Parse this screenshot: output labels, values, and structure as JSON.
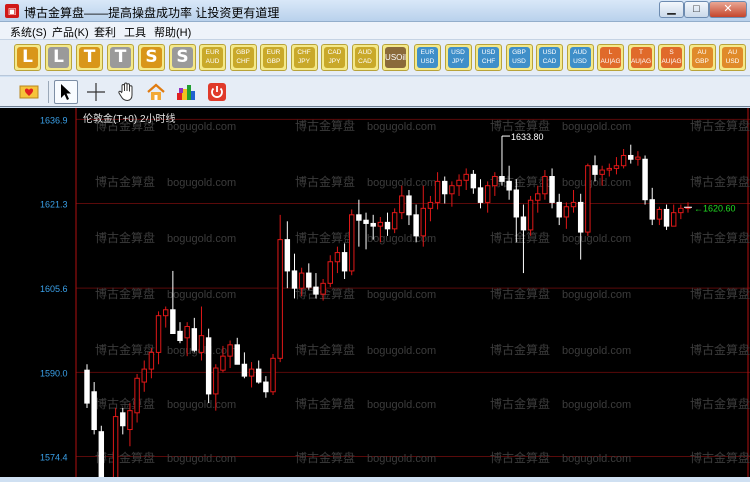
{
  "window": {
    "title": "博古金算盘——提高操盘成功率 让投资更有道理",
    "app_icon": "abacus-logo-icon",
    "controls": {
      "minimize": "▁",
      "maximize": "□",
      "close": "✕"
    }
  },
  "menu": {
    "items": [
      {
        "label": "系统(S)"
      },
      {
        "label": "产品(K)"
      },
      {
        "label": "套利"
      },
      {
        "label": "工具"
      },
      {
        "label": "帮助(H)"
      }
    ]
  },
  "toolbar": {
    "letter_buttons": [
      {
        "label": "L",
        "color": "#d9961a"
      },
      {
        "label": "L",
        "color": "#9a9a9a"
      },
      {
        "label": "T",
        "color": "#d9961a"
      },
      {
        "label": "T",
        "color": "#9a9a9a"
      },
      {
        "label": "S",
        "color": "#d9961a"
      },
      {
        "label": "S",
        "color": "#9a9a9a"
      }
    ],
    "pair_buttons": [
      {
        "top": "EUR",
        "bottom": "AUD",
        "color": "#c9a92a"
      },
      {
        "top": "GBP",
        "bottom": "CHF",
        "color": "#c9a92a"
      },
      {
        "top": "EUR",
        "bottom": "GBP",
        "color": "#c9a92a"
      },
      {
        "top": "CHF",
        "bottom": "JPY",
        "color": "#c9a92a"
      },
      {
        "top": "CAD",
        "bottom": "JPY",
        "color": "#c9a92a"
      },
      {
        "top": "AUD",
        "bottom": "CAD",
        "color": "#c9a92a"
      },
      {
        "top": "USOil",
        "bottom": "",
        "color": "#8a6a3a"
      },
      {
        "top": "EUR",
        "bottom": "USD",
        "color": "#3f8fc9"
      },
      {
        "top": "USD",
        "bottom": "JPY",
        "color": "#3f8fc9"
      },
      {
        "top": "USD",
        "bottom": "CHF",
        "color": "#3f8fc9"
      },
      {
        "top": "GBP",
        "bottom": "USD",
        "color": "#3f8fc9"
      },
      {
        "top": "USD",
        "bottom": "CAD",
        "color": "#3f8fc9"
      },
      {
        "top": "AUD",
        "bottom": "USD",
        "color": "#3f8fc9"
      },
      {
        "top": "L",
        "bottom": "AU|AG",
        "color": "#e06a2a"
      },
      {
        "top": "T",
        "bottom": "AU|AG",
        "color": "#e06a2a"
      },
      {
        "top": "S",
        "bottom": "AU|AG",
        "color": "#e06a2a"
      },
      {
        "top": "AU",
        "bottom": "GBP",
        "color": "#e08a2a"
      },
      {
        "top": "AU",
        "bottom": "USD",
        "color": "#e08a2a"
      }
    ]
  },
  "tools": [
    {
      "name": "envelope-icon",
      "selected": false
    },
    {
      "name": "arrow-cursor-icon",
      "selected": true
    },
    {
      "name": "crosshair-icon",
      "selected": false
    },
    {
      "name": "hand-icon",
      "selected": false
    },
    {
      "name": "home-icon",
      "selected": false
    },
    {
      "name": "color-blocks-icon",
      "selected": false
    },
    {
      "name": "power-icon",
      "selected": false
    }
  ],
  "chart": {
    "title": "伦敦金(T+0) 2小时线",
    "watermark_cn": "博古金算盘",
    "watermark_en": "bogugold.com",
    "max_label": "1633.80",
    "last_label": "←1620.60",
    "colors": {
      "up": "#e01818",
      "down": "#ffffff",
      "axis_text": "#3aa0e8",
      "grid": "#5a0a0a",
      "last": "#22dd22"
    }
  },
  "chart_data": {
    "type": "candlestick",
    "title": "伦敦金(T+0) 2小时线",
    "y_ticks": [
      1636.9,
      1621.3,
      1605.6,
      1590.0,
      1574.4
    ],
    "ylim": [
      1570.6,
      1639.0
    ],
    "annotations": [
      {
        "text": "1633.80",
        "value": 1633.8
      },
      {
        "text": "←1620.60",
        "value": 1620.6
      }
    ],
    "candles": [
      [
        1590.4,
        1591.5,
        1583.4,
        1584.3
      ],
      [
        1586.4,
        1588.2,
        1578.5,
        1579.4
      ],
      [
        1579.0,
        1580.1,
        1566.2,
        1568.0
      ],
      [
        1567.3,
        1569.8,
        1564.4,
        1568.0
      ],
      [
        1568.4,
        1583.4,
        1566.6,
        1581.8
      ],
      [
        1582.5,
        1583.4,
        1578.5,
        1580.1
      ],
      [
        1579.4,
        1584.3,
        1576.3,
        1582.9
      ],
      [
        1582.5,
        1589.7,
        1580.7,
        1588.9
      ],
      [
        1588.2,
        1592.2,
        1586.4,
        1590.6
      ],
      [
        1590.6,
        1594.5,
        1588.9,
        1593.7
      ],
      [
        1593.7,
        1601.3,
        1591.5,
        1600.5
      ],
      [
        1600.5,
        1602.2,
        1598.3,
        1601.6
      ],
      [
        1601.6,
        1608.8,
        1597.2,
        1597.2
      ],
      [
        1597.6,
        1599.3,
        1595.4,
        1595.9
      ],
      [
        1596.4,
        1599.3,
        1593.0,
        1598.5
      ],
      [
        1598.1,
        1600.1,
        1593.7,
        1594.1
      ],
      [
        1593.7,
        1602.2,
        1592.2,
        1596.8
      ],
      [
        1596.4,
        1598.1,
        1584.3,
        1586.0
      ],
      [
        1586.0,
        1591.5,
        1582.9,
        1590.8
      ],
      [
        1590.4,
        1594.9,
        1590.0,
        1593.0
      ],
      [
        1593.0,
        1595.9,
        1590.8,
        1595.1
      ],
      [
        1595.1,
        1596.4,
        1591.5,
        1591.5
      ],
      [
        1591.5,
        1593.7,
        1588.9,
        1589.3
      ],
      [
        1589.3,
        1591.9,
        1587.2,
        1590.6
      ],
      [
        1590.6,
        1592.2,
        1587.9,
        1588.2
      ],
      [
        1588.2,
        1589.3,
        1585.3,
        1586.4
      ],
      [
        1586.4,
        1593.4,
        1585.8,
        1592.6
      ],
      [
        1592.6,
        1619.2,
        1591.9,
        1614.6
      ],
      [
        1614.6,
        1618.0,
        1605.6,
        1608.8
      ],
      [
        1608.8,
        1612.0,
        1603.7,
        1605.6
      ],
      [
        1605.6,
        1609.4,
        1604.1,
        1608.4
      ],
      [
        1608.4,
        1610.2,
        1605.3,
        1605.8
      ],
      [
        1605.8,
        1608.4,
        1603.7,
        1604.5
      ],
      [
        1604.5,
        1607.3,
        1603.3,
        1606.5
      ],
      [
        1606.5,
        1611.7,
        1605.8,
        1610.5
      ],
      [
        1610.5,
        1613.3,
        1608.4,
        1612.2
      ],
      [
        1612.2,
        1613.9,
        1607.3,
        1608.8
      ],
      [
        1608.8,
        1620.2,
        1608.0,
        1619.2
      ],
      [
        1619.2,
        1622.0,
        1613.3,
        1618.2
      ],
      [
        1618.2,
        1619.6,
        1612.8,
        1617.6
      ],
      [
        1617.6,
        1619.2,
        1614.6,
        1617.1
      ],
      [
        1617.1,
        1618.8,
        1614.1,
        1617.8
      ],
      [
        1617.8,
        1619.6,
        1615.3,
        1616.6
      ],
      [
        1616.6,
        1620.4,
        1615.8,
        1619.6
      ],
      [
        1619.6,
        1624.6,
        1618.4,
        1622.7
      ],
      [
        1622.7,
        1623.8,
        1617.3,
        1619.2
      ],
      [
        1619.2,
        1621.1,
        1614.1,
        1615.3
      ],
      [
        1615.3,
        1624.6,
        1613.3,
        1620.4
      ],
      [
        1620.4,
        1622.7,
        1618.0,
        1621.5
      ],
      [
        1621.5,
        1627.1,
        1620.2,
        1625.4
      ],
      [
        1625.4,
        1626.3,
        1621.3,
        1623.1
      ],
      [
        1623.1,
        1625.4,
        1620.7,
        1624.6
      ],
      [
        1624.6,
        1626.7,
        1622.7,
        1625.6
      ],
      [
        1625.6,
        1627.8,
        1623.8,
        1626.7
      ],
      [
        1626.7,
        1627.5,
        1623.1,
        1624.2
      ],
      [
        1624.2,
        1625.8,
        1620.4,
        1621.5
      ],
      [
        1621.5,
        1625.4,
        1619.6,
        1624.6
      ],
      [
        1624.6,
        1627.1,
        1622.7,
        1626.3
      ],
      [
        1626.3,
        1633.8,
        1624.6,
        1625.4
      ],
      [
        1625.4,
        1628.3,
        1622.0,
        1623.8
      ],
      [
        1623.8,
        1625.8,
        1614.1,
        1618.8
      ],
      [
        1618.8,
        1621.1,
        1608.4,
        1616.4
      ],
      [
        1616.4,
        1622.7,
        1615.3,
        1621.9
      ],
      [
        1621.9,
        1624.6,
        1619.6,
        1623.1
      ],
      [
        1623.1,
        1627.5,
        1622.0,
        1626.3
      ],
      [
        1626.3,
        1627.8,
        1620.4,
        1621.5
      ],
      [
        1621.5,
        1623.1,
        1617.3,
        1618.8
      ],
      [
        1618.8,
        1621.5,
        1616.6,
        1620.7
      ],
      [
        1620.7,
        1623.8,
        1619.6,
        1621.5
      ],
      [
        1621.5,
        1623.1,
        1610.9,
        1616.0
      ],
      [
        1616.0,
        1628.7,
        1615.3,
        1628.3
      ],
      [
        1628.3,
        1630.2,
        1625.4,
        1626.7
      ],
      [
        1626.7,
        1628.3,
        1624.6,
        1627.5
      ],
      [
        1627.5,
        1628.7,
        1626.3,
        1627.8
      ],
      [
        1627.8,
        1629.9,
        1626.7,
        1628.3
      ],
      [
        1628.3,
        1631.4,
        1627.8,
        1630.2
      ],
      [
        1630.2,
        1632.2,
        1628.7,
        1629.5
      ],
      [
        1629.5,
        1631.0,
        1628.3,
        1629.9
      ],
      [
        1629.5,
        1630.2,
        1621.1,
        1622.0
      ],
      [
        1622.0,
        1624.2,
        1617.3,
        1618.4
      ],
      [
        1618.4,
        1620.7,
        1617.3,
        1620.2
      ],
      [
        1620.2,
        1621.1,
        1616.4,
        1617.1
      ],
      [
        1617.1,
        1621.1,
        1617.1,
        1619.6
      ],
      [
        1619.6,
        1621.1,
        1618.4,
        1620.4
      ],
      [
        1620.4,
        1621.5,
        1619.6,
        1620.6
      ]
    ]
  }
}
